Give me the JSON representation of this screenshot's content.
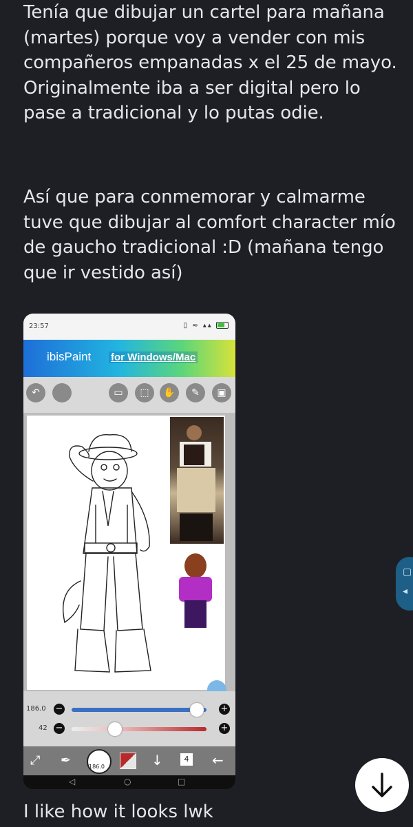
{
  "message": {
    "paragraph1": "Tenía que dibujar un cartel para mañana\n(martes) porque voy a vender con mis\ncompañeros empanadas x el 25 de mayo.\nOriginalmente iba a ser digital pero lo\npase a tradicional y lo putas odie.",
    "paragraph2": "Así que para conmemorar y calmarme\ntuve que dibujar al comfort character mío\nde gaucho tradicional :D (mañana tengo\nque ir vestido así)",
    "caption": "I like how it looks lwk"
  },
  "phone": {
    "status_time": "23:57",
    "banner_brand": "ibisPaint",
    "banner_link": "for Windows/Mac",
    "brush_size_label": "186.0",
    "opacity_label": "42",
    "brush_size_value": 0.93,
    "opacity_value": 0.32,
    "layer_count": "4",
    "brush_preview_text": "186.0"
  },
  "icons": {
    "scroll_down": "arrow-down-icon",
    "undo": "undo-icon",
    "redo": "redo-icon"
  },
  "colors": {
    "background": "#1e1f24",
    "text": "#e6e6ea",
    "accent_blue": "#3a6fc4",
    "accent_red": "#b72a2a"
  }
}
